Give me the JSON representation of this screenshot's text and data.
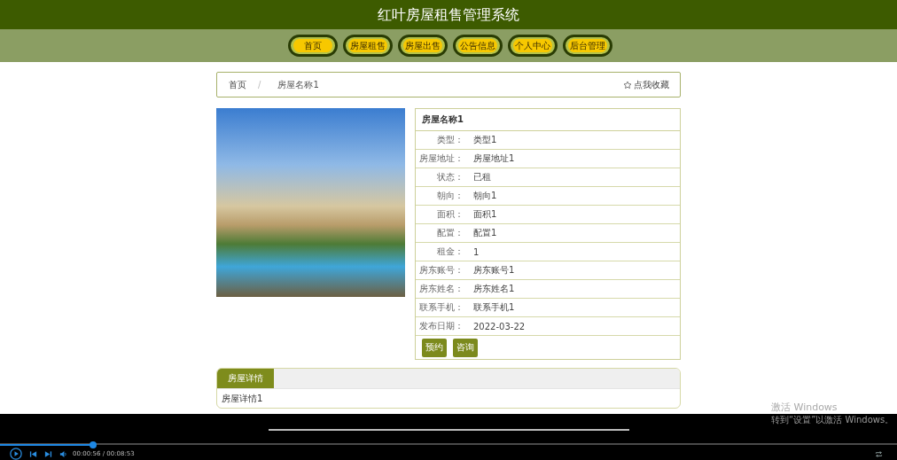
{
  "header": {
    "title": "红叶房屋租售管理系统"
  },
  "nav": [
    "首页",
    "房屋租售",
    "房屋出售",
    "公告信息",
    "个人中心",
    "后台管理"
  ],
  "breadcrumb": {
    "home": "首页",
    "separator": "/",
    "current": "房屋名称1"
  },
  "favorite": {
    "label": "点我收藏"
  },
  "details": {
    "title": "房屋名称1",
    "fields": [
      {
        "label": "类型：",
        "value": "类型1"
      },
      {
        "label": "房屋地址：",
        "value": "房屋地址1"
      },
      {
        "label": "状态：",
        "value": "已租"
      },
      {
        "label": "朝向：",
        "value": "朝向1"
      },
      {
        "label": "面积：",
        "value": "面积1"
      },
      {
        "label": "配置：",
        "value": "配置1"
      },
      {
        "label": "租金：",
        "value": "1"
      },
      {
        "label": "房东账号：",
        "value": "房东账号1"
      },
      {
        "label": "房东姓名：",
        "value": "房东姓名1"
      },
      {
        "label": "联系手机：",
        "value": "联系手机1"
      },
      {
        "label": "发布日期：",
        "value": "2022-03-22"
      }
    ],
    "buttons": [
      "预约",
      "咨询"
    ]
  },
  "tabs": [
    {
      "label": "房屋详情",
      "selected": true
    }
  ],
  "tab_content": "房屋详情1",
  "player": {
    "level": 0.104,
    "time": "00:00:56 / 00:08:53"
  },
  "system_notice": {
    "title": "激活 Windows",
    "text": "转到“设置”以激活 Windows。"
  }
}
